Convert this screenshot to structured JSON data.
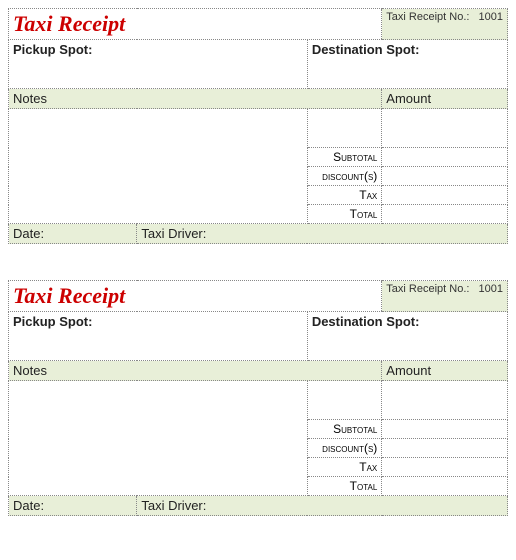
{
  "receipts": [
    {
      "title": "Taxi Receipt",
      "receipt_no_label": "Taxi Receipt No.:",
      "receipt_no": "1001",
      "pickup_label": "Pickup Spot:",
      "destination_label": "Destination Spot:",
      "notes_header": "Notes",
      "amount_header": "Amount",
      "subtotal_label": "Subtotal",
      "discounts_label": "discount(s)",
      "tax_label": "Tax",
      "total_label": "Total",
      "date_label": "Date:",
      "driver_label": "Taxi Driver:"
    },
    {
      "title": "Taxi Receipt",
      "receipt_no_label": "Taxi Receipt No.:",
      "receipt_no": "1001",
      "pickup_label": "Pickup Spot:",
      "destination_label": "Destination Spot:",
      "notes_header": "Notes",
      "amount_header": "Amount",
      "subtotal_label": "Subtotal",
      "discounts_label": "discount(s)",
      "tax_label": "Tax",
      "total_label": "Total",
      "date_label": "Date:",
      "driver_label": "Taxi Driver:"
    }
  ]
}
